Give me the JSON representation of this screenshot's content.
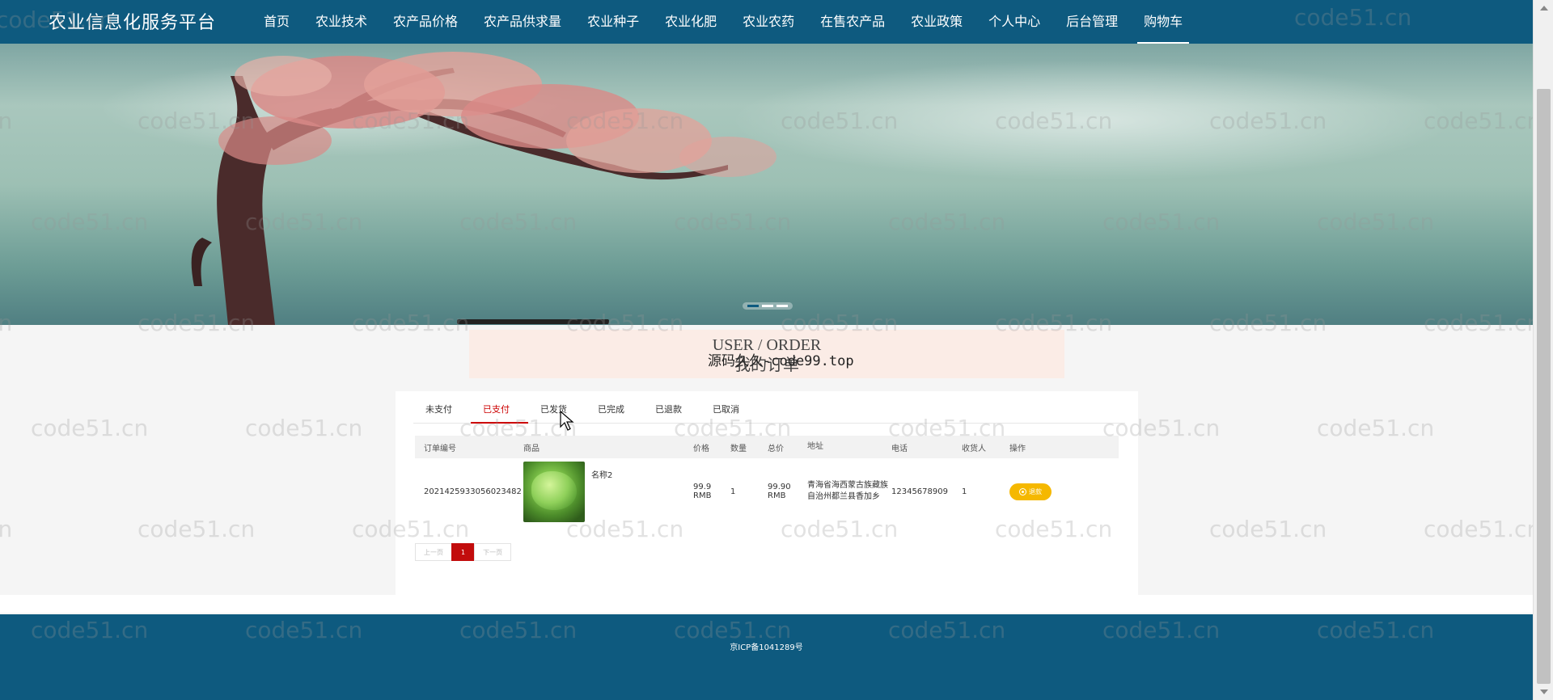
{
  "site": {
    "brand": "农业信息化服务平台"
  },
  "nav": {
    "items": [
      {
        "label": "首页"
      },
      {
        "label": "农业技术"
      },
      {
        "label": "农产品价格"
      },
      {
        "label": "农产品供求量"
      },
      {
        "label": "农业种子"
      },
      {
        "label": "农业化肥"
      },
      {
        "label": "农业农药"
      },
      {
        "label": "在售农产品"
      },
      {
        "label": "农业政策"
      },
      {
        "label": "个人中心"
      },
      {
        "label": "后台管理"
      },
      {
        "label": "购物车"
      }
    ],
    "active_index": 11
  },
  "banner": {
    "slides": 3,
    "active_slide": 0
  },
  "section": {
    "title_en": "USER / ORDER",
    "title_cn": "我的订单",
    "overlay_text": "源码久久-code99.top"
  },
  "order_tabs": [
    "未支付",
    "已支付",
    "已发货",
    "已完成",
    "已退款",
    "已取消"
  ],
  "active_tab": 1,
  "table": {
    "headers": [
      "订单编号",
      "商品",
      "价格",
      "数量",
      "总价",
      "地址",
      "电话",
      "收货人",
      "操作"
    ],
    "rows": [
      {
        "order_no": "2021425933056023482",
        "product_name": "名称2",
        "price": "99.9 RMB",
        "quantity": "1",
        "total": "99.90 RMB",
        "address": "青海省海西蒙古族藏族自治州都兰县香加乡",
        "phone": "12345678909",
        "receiver": "1",
        "action": "退款"
      }
    ]
  },
  "pager": {
    "prev": "上一页",
    "current": "1",
    "next": "下一页"
  },
  "footer": {
    "icp": "京ICP备1041289号"
  },
  "watermark": "code51.cn",
  "colors": {
    "nav_bg": "#0e5a7f",
    "active_red": "#c20c0c",
    "refund_button": "#f5b800",
    "title_bg": "#fbece6"
  }
}
